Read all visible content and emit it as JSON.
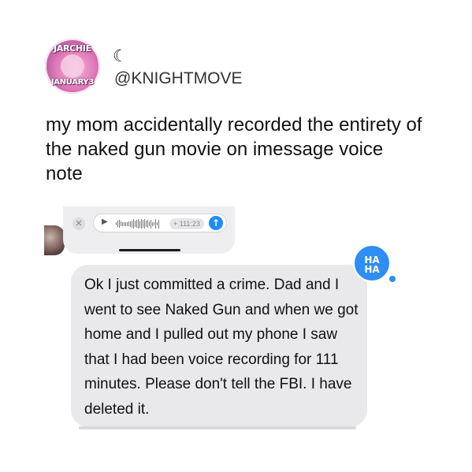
{
  "avatar": {
    "text_top": "JARCHIE",
    "text_bottom": "JANUARY3"
  },
  "profile": {
    "moon_glyph": "☾",
    "handle": "@KNIGHTMOVE"
  },
  "tweet": {
    "text": "my mom accidentally recorded the entirety of the naked gun movie on imessage voice note"
  },
  "voice_note": {
    "close_glyph": "✕",
    "play_glyph": "▶",
    "duration": "+ 111:23",
    "send_glyph": "↑"
  },
  "message": {
    "text": "Ok I just committed a crime. Dad and I went to see Naked Gun and when we got home and I pulled out my phone I saw that I had been voice recording for 111 minutes. Please don't tell the FBI. I have deleted it."
  },
  "reaction": {
    "line1": "HA",
    "line2": "HA"
  },
  "colors": {
    "accent_blue": "#2e8ef3",
    "bubble_gray": "#e9e9eb"
  }
}
